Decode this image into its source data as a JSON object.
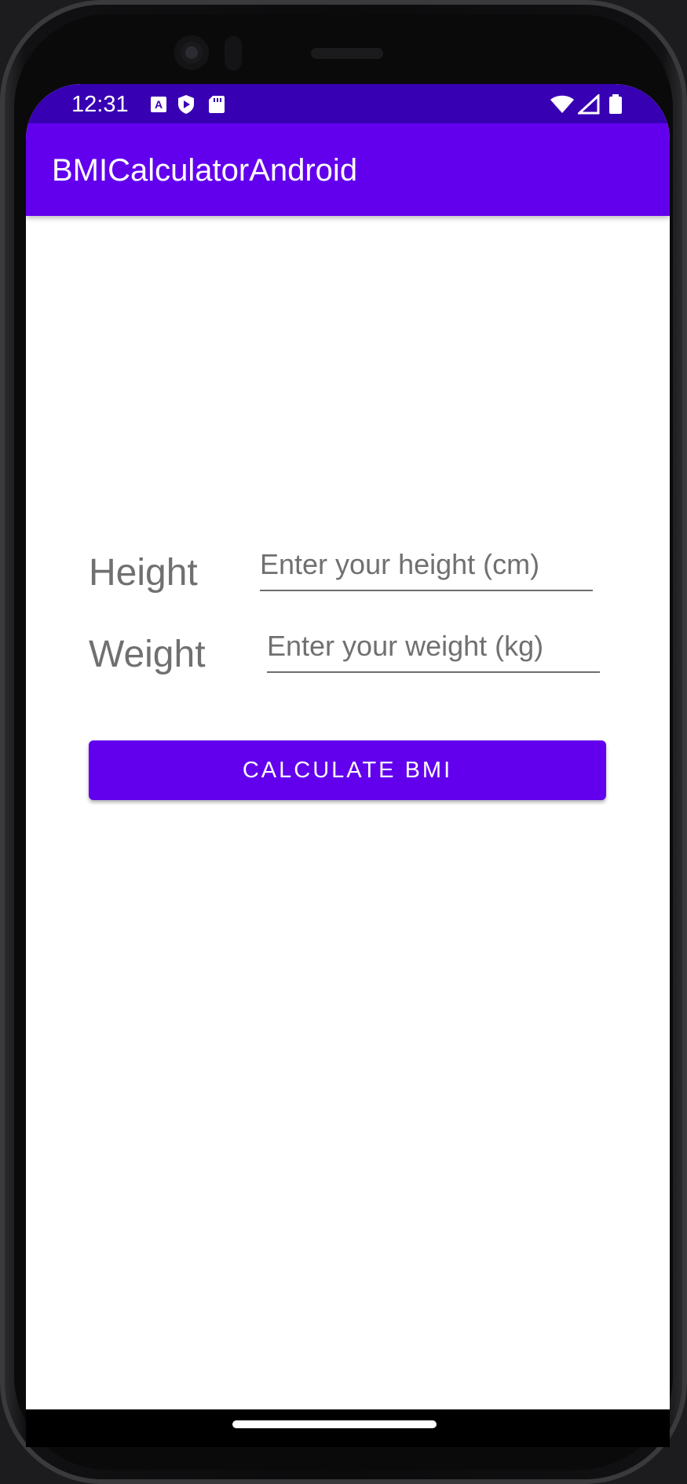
{
  "status_bar": {
    "time": "12:31",
    "left_icons": [
      "a-notification-icon",
      "shield-play-icon",
      "sd-card-icon"
    ],
    "right_icons": [
      "wifi-icon",
      "signal-icon",
      "battery-icon"
    ],
    "color": "#3700b3"
  },
  "app_bar": {
    "title": "BMICalculatorAndroid",
    "color": "#6200ee"
  },
  "form": {
    "height_label": "Height",
    "height_placeholder": "Enter your height (cm)",
    "height_value": "",
    "weight_label": "Weight",
    "weight_placeholder": "Enter your weight (kg)",
    "weight_value": ""
  },
  "actions": {
    "calculate_label": "CALCULATE BMI",
    "button_color": "#6200ee"
  }
}
